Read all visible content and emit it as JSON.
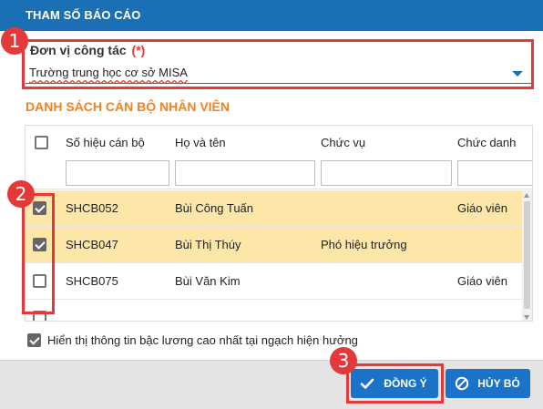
{
  "dialog": {
    "title": "THAM SỐ BÁO CÁO"
  },
  "unit_field": {
    "label": "Đơn vị công tác",
    "required_mark": "(*)",
    "value": "Trường trung học cơ sở MISA"
  },
  "staff_list": {
    "title": "DANH SÁCH CÁN BỘ NHÂN VIÊN",
    "columns": [
      "Số hiệu cán bộ",
      "Họ và tên",
      "Chức vụ",
      "Chức danh"
    ],
    "rows": [
      {
        "checked": true,
        "code": "SHCB052",
        "name": "Bùi Công Tuấn",
        "position": "",
        "title": "Giáo viên"
      },
      {
        "checked": true,
        "code": "SHCB047",
        "name": "Bùi Thị Thúy",
        "position": "Phó hiệu trưởng",
        "title": ""
      },
      {
        "checked": false,
        "code": "SHCB075",
        "name": "Bùi Văn Kim",
        "position": "",
        "title": "Giáo viên"
      }
    ]
  },
  "option": {
    "checked": true,
    "label": "Hiển thị thông tin bậc lương cao nhất tại ngạch hiện hưởng"
  },
  "buttons": {
    "ok": "ĐỒNG Ý",
    "cancel": "HỦY BỎ"
  },
  "annotations": {
    "badge_1": "1",
    "badge_2": "2",
    "badge_3": "3",
    "color": "#e53939"
  },
  "colors": {
    "primary": "#1a6fb5",
    "accent": "#f5811f",
    "selected_row": "#fde7a8"
  }
}
